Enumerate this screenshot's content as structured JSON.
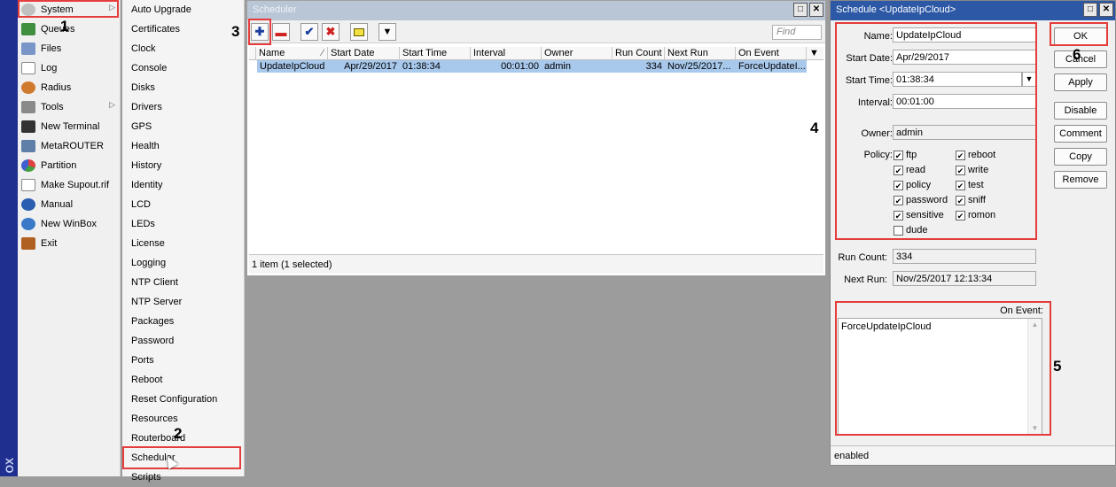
{
  "main_menu": {
    "items": [
      {
        "label": "System",
        "icon": "gear-icon",
        "has_submenu": true
      },
      {
        "label": "Queues",
        "icon": "queue-icon",
        "has_submenu": false
      },
      {
        "label": "Files",
        "icon": "folder-icon",
        "has_submenu": false
      },
      {
        "label": "Log",
        "icon": "log-icon",
        "has_submenu": false
      },
      {
        "label": "Radius",
        "icon": "users-icon",
        "has_submenu": false
      },
      {
        "label": "Tools",
        "icon": "tools-icon",
        "has_submenu": true
      },
      {
        "label": "New Terminal",
        "icon": "terminal-icon",
        "has_submenu": false
      },
      {
        "label": "MetaROUTER",
        "icon": "router-icon",
        "has_submenu": false
      },
      {
        "label": "Partition",
        "icon": "pie-icon",
        "has_submenu": false
      },
      {
        "label": "Make Supout.rif",
        "icon": "document-icon",
        "has_submenu": false
      },
      {
        "label": "Manual",
        "icon": "help-icon",
        "has_submenu": false
      },
      {
        "label": "New WinBox",
        "icon": "winbox-icon",
        "has_submenu": false
      },
      {
        "label": "Exit",
        "icon": "exit-icon",
        "has_submenu": false
      }
    ],
    "strip_text": "OX"
  },
  "submenu": {
    "items": [
      "Auto Upgrade",
      "Certificates",
      "Clock",
      "Console",
      "Disks",
      "Drivers",
      "GPS",
      "Health",
      "History",
      "Identity",
      "LCD",
      "LEDs",
      "License",
      "Logging",
      "NTP Client",
      "NTP Server",
      "Packages",
      "Password",
      "Ports",
      "Reboot",
      "Reset Configuration",
      "Resources",
      "Routerboard",
      "Scheduler",
      "Scripts"
    ]
  },
  "scheduler": {
    "title": "Scheduler",
    "find_placeholder": "Find",
    "columns": [
      "Name",
      "Start Date",
      "Start Time",
      "Interval",
      "Owner",
      "Run Count",
      "Next Run",
      "On Event"
    ],
    "rows": [
      {
        "name": "UpdateIpCloud",
        "start_date": "Apr/29/2017",
        "start_time": "01:38:34",
        "interval": "00:01:00",
        "owner": "admin",
        "run_count": "334",
        "next_run": "Nov/25/2017...",
        "on_event": "ForceUpdateI..."
      }
    ],
    "status": "1 item (1 selected)"
  },
  "dialog": {
    "title": "Schedule <UpdateIpCloud>",
    "fields": {
      "name_label": "Name:",
      "name_value": "UpdateIpCloud",
      "start_date_label": "Start Date:",
      "start_date_value": "Apr/29/2017",
      "start_time_label": "Start Time:",
      "start_time_value": "01:38:34",
      "interval_label": "Interval:",
      "interval_value": "00:01:00",
      "owner_label": "Owner:",
      "owner_value": "admin",
      "policy_label": "Policy:",
      "run_count_label": "Run Count:",
      "run_count_value": "334",
      "next_run_label": "Next Run:",
      "next_run_value": "Nov/25/2017 12:13:34",
      "on_event_label": "On Event:",
      "on_event_value": "ForceUpdateIpCloud"
    },
    "policies": [
      {
        "label": "ftp",
        "checked": true
      },
      {
        "label": "reboot",
        "checked": true
      },
      {
        "label": "read",
        "checked": true
      },
      {
        "label": "write",
        "checked": true
      },
      {
        "label": "policy",
        "checked": true
      },
      {
        "label": "test",
        "checked": true
      },
      {
        "label": "password",
        "checked": true
      },
      {
        "label": "sniff",
        "checked": true
      },
      {
        "label": "sensitive",
        "checked": true
      },
      {
        "label": "romon",
        "checked": true
      },
      {
        "label": "dude",
        "checked": false
      }
    ],
    "buttons": [
      "OK",
      "Cancel",
      "Apply",
      "Disable",
      "Comment",
      "Copy",
      "Remove"
    ],
    "status": "enabled"
  },
  "annotations": [
    "1",
    "2",
    "3",
    "4",
    "5",
    "6"
  ],
  "colors": {
    "accent_blue": "#2c58a6",
    "selection": "#a8c8ec",
    "highlight_red": "#e53c3c",
    "strip": "#1e2f8f"
  }
}
